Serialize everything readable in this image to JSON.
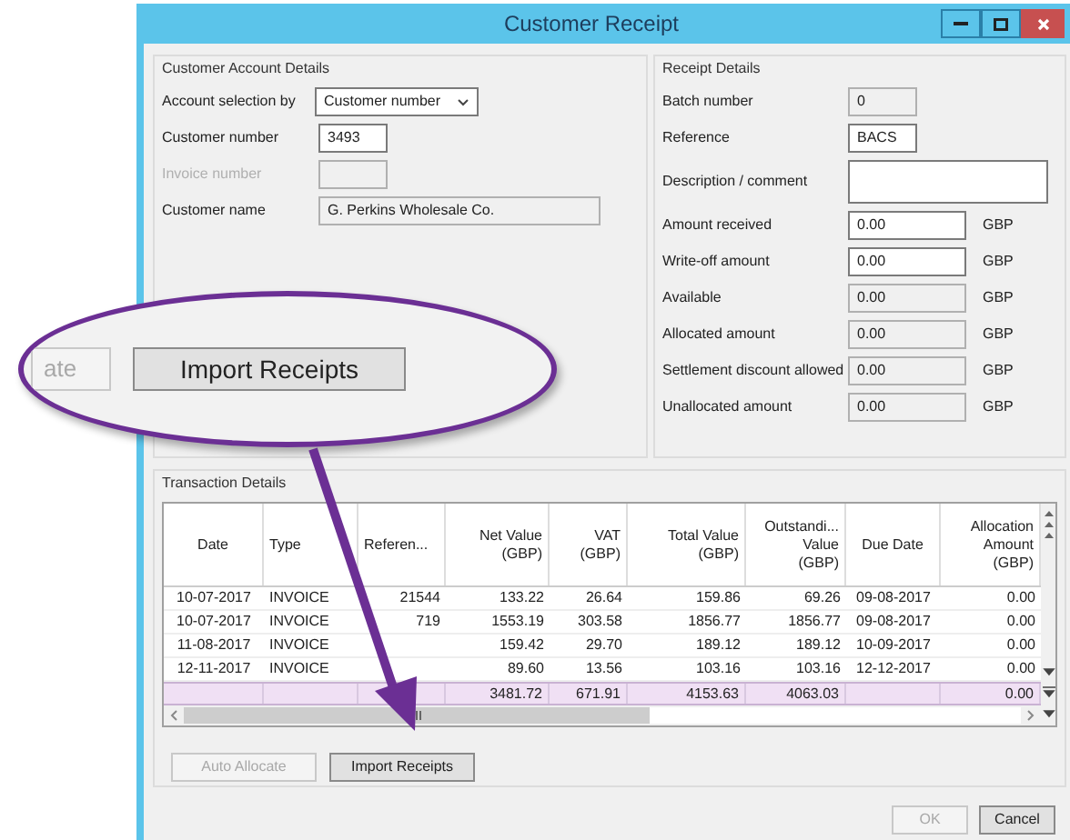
{
  "window": {
    "title": "Customer Receipt"
  },
  "customer_account": {
    "title": "Customer Account Details",
    "fields": [
      {
        "label": "Account selection by",
        "kind": "select",
        "value": "Customer number",
        "disabled": false
      },
      {
        "label": "Customer number",
        "kind": "text",
        "value": "3493",
        "disabled": false
      },
      {
        "label": "Invoice number",
        "kind": "text",
        "disabled": true
      },
      {
        "label": "Customer name",
        "kind": "readonly",
        "value": "G. Perkins Wholesale Co.",
        "disabled": false
      }
    ]
  },
  "receipt": {
    "title": "Receipt Details",
    "fields": [
      {
        "label": "Batch number",
        "kind": "readonly",
        "value": "0"
      },
      {
        "label": "Reference",
        "kind": "text",
        "value": "BACS"
      },
      {
        "label": "Description / comment",
        "kind": "multiline"
      },
      {
        "label": "Amount received",
        "kind": "text",
        "value": "0.00",
        "unit": "GBP"
      },
      {
        "label": "Write-off amount",
        "kind": "text",
        "value": "0.00",
        "unit": "GBP"
      },
      {
        "label": "Available",
        "kind": "readonly",
        "value": "0.00",
        "unit": "GBP"
      },
      {
        "label": "Allocated amount",
        "kind": "readonly",
        "value": "0.00",
        "unit": "GBP"
      },
      {
        "label": "Settlement discount allowed",
        "kind": "readonly",
        "value": "0.00",
        "unit": "GBP"
      },
      {
        "label": "Unallocated amount",
        "kind": "readonly",
        "value": "0.00",
        "unit": "GBP"
      }
    ]
  },
  "transactions": {
    "title": "Transaction Details",
    "columns": [
      "Date",
      "Type",
      "Referen...",
      "Net Value\n(GBP)",
      "VAT\n(GBP)",
      "Total Value\n(GBP)",
      "Outstandi...\nValue\n(GBP)",
      "Due Date",
      "Allocation\nAmount\n(GBP)"
    ],
    "rows": [
      {
        "date": "10-07-2017",
        "type": "INVOICE",
        "reference": "21544",
        "net_value": "133.22",
        "vat": "26.64",
        "total_value": "159.86",
        "outstanding_value": "69.26",
        "due_date": "09-08-2017",
        "allocation_amount": "0.00"
      },
      {
        "date": "10-07-2017",
        "type": "INVOICE",
        "reference": "719",
        "net_value": "1553.19",
        "vat": "303.58",
        "total_value": "1856.77",
        "outstanding_value": "1856.77",
        "due_date": "09-08-2017",
        "allocation_amount": "0.00"
      },
      {
        "date": "11-08-2017",
        "type": "INVOICE",
        "net_value": "159.42",
        "vat": "29.70",
        "total_value": "189.12",
        "outstanding_value": "189.12",
        "due_date": "10-09-2017",
        "allocation_amount": "0.00"
      },
      {
        "date": "12-11-2017",
        "type": "INVOICE",
        "net_value": "89.60",
        "vat": "13.56",
        "total_value": "103.16",
        "outstanding_value": "103.16",
        "due_date": "12-12-2017",
        "allocation_amount": "0.00"
      }
    ],
    "totals": {
      "net_value": "3481.72",
      "vat": "671.91",
      "total_value": "4153.63",
      "outstanding_value": "4063.03",
      "allocation_amount": "0.00"
    },
    "buttons": [
      {
        "label": "Auto Allocate",
        "disabled": true
      },
      {
        "label": "Import Receipts",
        "disabled": false
      }
    ]
  },
  "dialog_buttons": [
    {
      "label": "OK",
      "disabled": true
    },
    {
      "label": "Cancel",
      "disabled": false
    }
  ],
  "callout": {
    "buttons": [
      {
        "label": "ate",
        "disabled": true
      },
      {
        "label": "Import Receipts",
        "disabled": false
      }
    ]
  }
}
